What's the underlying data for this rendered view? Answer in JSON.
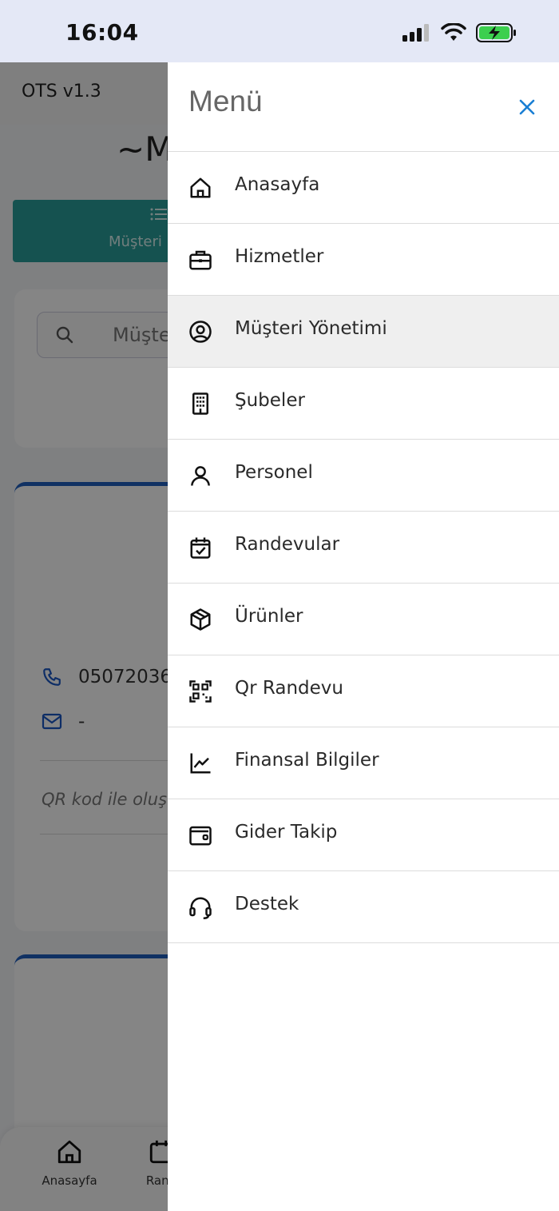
{
  "status_bar": {
    "time": "16:04"
  },
  "app": {
    "version": "OTS v1.3",
    "title_partial": "~M",
    "tab_label_partial": "Müşteri Lis",
    "search_placeholder_partial": "Müşte",
    "customer": {
      "phone_partial": "05072036",
      "email": "-",
      "note_partial": "QR kod ile oluş"
    },
    "bottom_nav": [
      {
        "label": "Anasayfa",
        "icon": "home-icon"
      },
      {
        "label": "Rand",
        "icon": "calendar-icon"
      }
    ]
  },
  "drawer": {
    "title": "Menü",
    "items": [
      {
        "label": "Anasayfa",
        "icon": "home-icon",
        "active": false
      },
      {
        "label": "Hizmetler",
        "icon": "briefcase-icon",
        "active": false
      },
      {
        "label": "Müşteri Yönetimi",
        "icon": "user-circle-icon",
        "active": true
      },
      {
        "label": "Şubeler",
        "icon": "building-icon",
        "active": false
      },
      {
        "label": "Personel",
        "icon": "person-icon",
        "active": false
      },
      {
        "label": "Randevular",
        "icon": "calendar-check-icon",
        "active": false
      },
      {
        "label": "Ürünler",
        "icon": "package-icon",
        "active": false
      },
      {
        "label": "Qr Randevu",
        "icon": "qr-code-icon",
        "active": false
      },
      {
        "label": "Finansal Bilgiler",
        "icon": "chart-line-icon",
        "active": false
      },
      {
        "label": "Gider Takip",
        "icon": "wallet-icon",
        "active": false
      },
      {
        "label": "Destek",
        "icon": "headset-icon",
        "active": false
      }
    ]
  },
  "colors": {
    "accent": "#1a7fd4",
    "tab_bg": "#2a9d99",
    "card_accent": "#1f5fbf",
    "battery": "#3ccf4e"
  }
}
